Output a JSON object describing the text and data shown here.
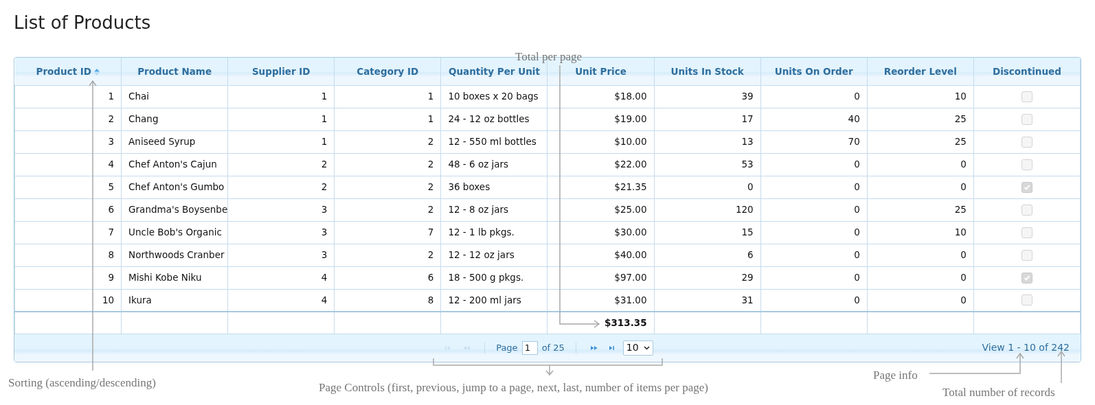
{
  "title": "List of Products",
  "columns": [
    {
      "label": "Product ID",
      "kind": "number",
      "sorted": true
    },
    {
      "label": "Product Name",
      "kind": "text",
      "sorted": false
    },
    {
      "label": "Supplier ID",
      "kind": "number",
      "sorted": false
    },
    {
      "label": "Category ID",
      "kind": "number",
      "sorted": false
    },
    {
      "label": "Quantity Per Unit",
      "kind": "text",
      "sorted": false
    },
    {
      "label": "Unit Price",
      "kind": "number",
      "sorted": false
    },
    {
      "label": "Units In Stock",
      "kind": "number",
      "sorted": false
    },
    {
      "label": "Units On Order",
      "kind": "number",
      "sorted": false
    },
    {
      "label": "Reorder Level",
      "kind": "number",
      "sorted": false
    },
    {
      "label": "Discontinued",
      "kind": "check",
      "sorted": false
    }
  ],
  "rows": [
    {
      "cells": [
        "1",
        "Chai",
        "1",
        "1",
        "10 boxes x 20 bags",
        "$18.00",
        "39",
        "0",
        "10"
      ],
      "discontinued": false
    },
    {
      "cells": [
        "2",
        "Chang",
        "1",
        "1",
        "24 - 12 oz bottles",
        "$19.00",
        "17",
        "40",
        "25"
      ],
      "discontinued": false
    },
    {
      "cells": [
        "3",
        "Aniseed Syrup",
        "1",
        "2",
        "12 - 550 ml bottles",
        "$10.00",
        "13",
        "70",
        "25"
      ],
      "discontinued": false
    },
    {
      "cells": [
        "4",
        "Chef Anton's Cajun",
        "2",
        "2",
        "48 - 6 oz jars",
        "$22.00",
        "53",
        "0",
        "0"
      ],
      "discontinued": false
    },
    {
      "cells": [
        "5",
        "Chef Anton's Gumbo",
        "2",
        "2",
        "36 boxes",
        "$21.35",
        "0",
        "0",
        "0"
      ],
      "discontinued": true
    },
    {
      "cells": [
        "6",
        "Grandma's Boysenbe",
        "3",
        "2",
        "12 - 8 oz jars",
        "$25.00",
        "120",
        "0",
        "25"
      ],
      "discontinued": false
    },
    {
      "cells": [
        "7",
        "Uncle Bob's Organic",
        "3",
        "7",
        "12 - 1 lb pkgs.",
        "$30.00",
        "15",
        "0",
        "10"
      ],
      "discontinued": false
    },
    {
      "cells": [
        "8",
        "Northwoods Cranber",
        "3",
        "2",
        "12 - 12 oz jars",
        "$40.00",
        "6",
        "0",
        "0"
      ],
      "discontinued": false
    },
    {
      "cells": [
        "9",
        "Mishi Kobe Niku",
        "4",
        "6",
        "18 - 500 g pkgs.",
        "$97.00",
        "29",
        "0",
        "0"
      ],
      "discontinued": true
    },
    {
      "cells": [
        "10",
        "Ikura",
        "4",
        "8",
        "12 - 200 ml jars",
        "$31.00",
        "31",
        "0",
        "0"
      ],
      "discontinued": false
    }
  ],
  "footer": {
    "unit_price_total": "$313.35"
  },
  "pager": {
    "first_disabled": true,
    "prev_disabled": true,
    "next_disabled": false,
    "last_disabled": false,
    "page_label": "Page",
    "page_value": "1",
    "of_pages": "of 25",
    "per_page": "10",
    "info": "View 1 - 10 of 242"
  },
  "annotations": [
    {
      "kind": "total",
      "text": "Total per page"
    },
    {
      "kind": "sorting",
      "text": "Sorting (ascending/descending)"
    },
    {
      "kind": "controls",
      "text": "Page Controls (first, previous, jump to a page, next, last, number of items per page)"
    },
    {
      "kind": "info",
      "text": "Page info"
    },
    {
      "kind": "records",
      "text": "Total number of records"
    }
  ]
}
